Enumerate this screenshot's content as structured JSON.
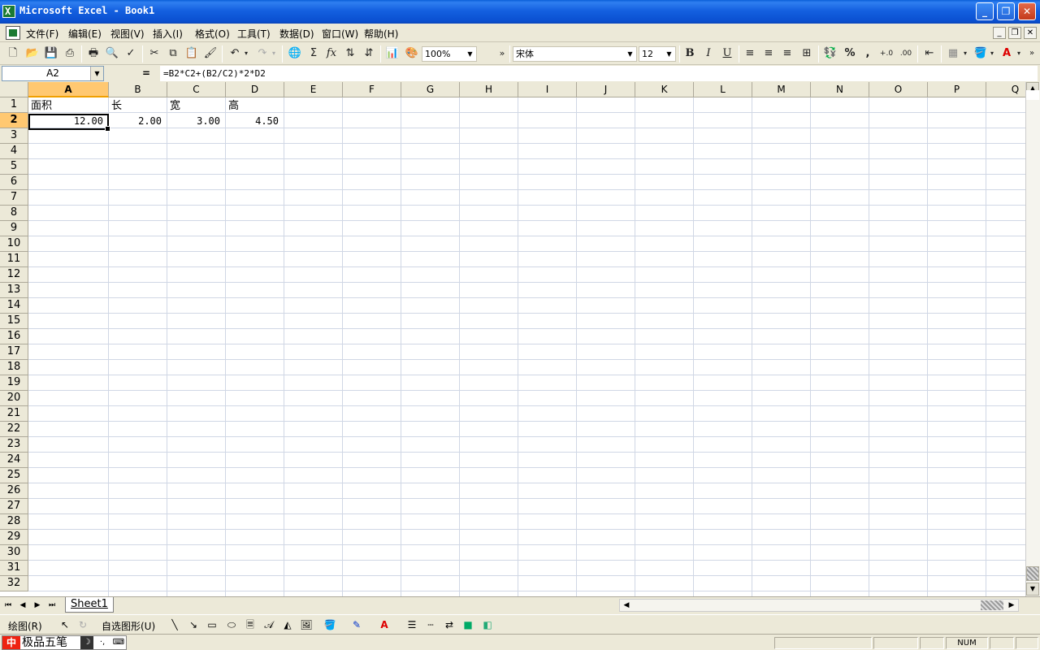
{
  "window": {
    "title": "Microsoft Excel - Book1",
    "minimize": "_",
    "restore": "❐",
    "close": "✕"
  },
  "menu": {
    "items": [
      "文件(F)",
      "编辑(E)",
      "视图(V)",
      "插入(I)",
      "格式(O)",
      "工具(T)",
      "数据(D)",
      "窗口(W)",
      "帮助(H)"
    ],
    "mdi": [
      "_",
      "❐",
      "✕"
    ]
  },
  "toolbar": {
    "zoom": "100%",
    "font_name": "宋体",
    "font_size": "12",
    "bold": "B",
    "italic": "I",
    "underline": "U",
    "sum": "Σ",
    "fx": "fx",
    "percent": "%",
    "comma": ","
  },
  "formula_bar": {
    "name_box": "A2",
    "equal": "=",
    "formula": "=B2*C2+(B2/C2)*2*D2"
  },
  "sheet": {
    "columns": [
      "A",
      "B",
      "C",
      "D",
      "E",
      "F",
      "G",
      "H",
      "I",
      "J",
      "K",
      "L",
      "M",
      "N",
      "O",
      "P",
      "Q"
    ],
    "rows": [
      "1",
      "2",
      "3",
      "4",
      "5",
      "6",
      "7",
      "8",
      "9",
      "10",
      "11",
      "12",
      "13",
      "14",
      "15",
      "16",
      "17",
      "18",
      "19",
      "20",
      "21",
      "22",
      "23",
      "24",
      "25",
      "26",
      "27",
      "28",
      "29",
      "30",
      "31",
      "32"
    ],
    "active_column": "A",
    "active_row": "2",
    "cells": {
      "A1": "面积",
      "B1": "长",
      "C1": "宽",
      "D1": "高",
      "A2": "12.00",
      "B2": "2.00",
      "C2": "3.00",
      "D2": "4.50"
    }
  },
  "tabs": {
    "sheet1": "Sheet1"
  },
  "drawing": {
    "draw_menu": "绘图(R)",
    "autoshapes": "自选图形(U)"
  },
  "status": {
    "ime_label": "中",
    "ime_name": "极品五笔",
    "num": "NUM"
  }
}
